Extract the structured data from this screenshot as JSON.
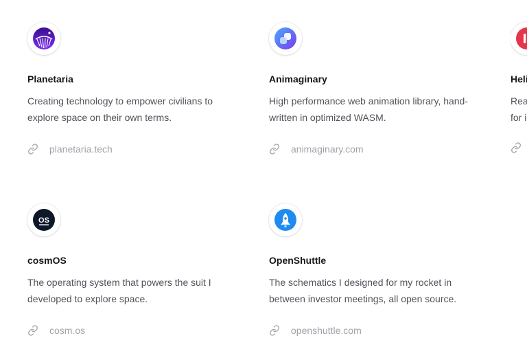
{
  "projects": [
    {
      "name": "Planetaria",
      "description": "Creating technology to empower civilians to explore space on their own terms.",
      "link": "planetaria.tech",
      "logo_icon": "planetaria-logo-icon"
    },
    {
      "name": "Animaginary",
      "description": "High performance web animation library, hand-written in optimized WASM.",
      "link": "animaginary.com",
      "logo_icon": "animaginary-logo-icon"
    },
    {
      "name": "Heli",
      "description": "Rea for i",
      "link": "",
      "logo_icon": "helio-logo-icon"
    },
    {
      "name": "cosmOS",
      "description": "The operating system that powers the suit I developed to explore space.",
      "link": "cosm.os",
      "logo_icon": "cosmos-logo-icon"
    },
    {
      "name": "OpenShuttle",
      "description": "The schematics I designed for my rocket in between investor meetings, all open source.",
      "link": "openshuttle.com",
      "logo_icon": "openshuttle-logo-icon"
    }
  ],
  "colors": {
    "title": "#18181b",
    "description": "#52525b",
    "link": "#a1a1aa",
    "helio_brand": "#e5344c",
    "animaginary_brand": "#5b5cf6",
    "openshuttle_brand": "#1d8bf0"
  }
}
